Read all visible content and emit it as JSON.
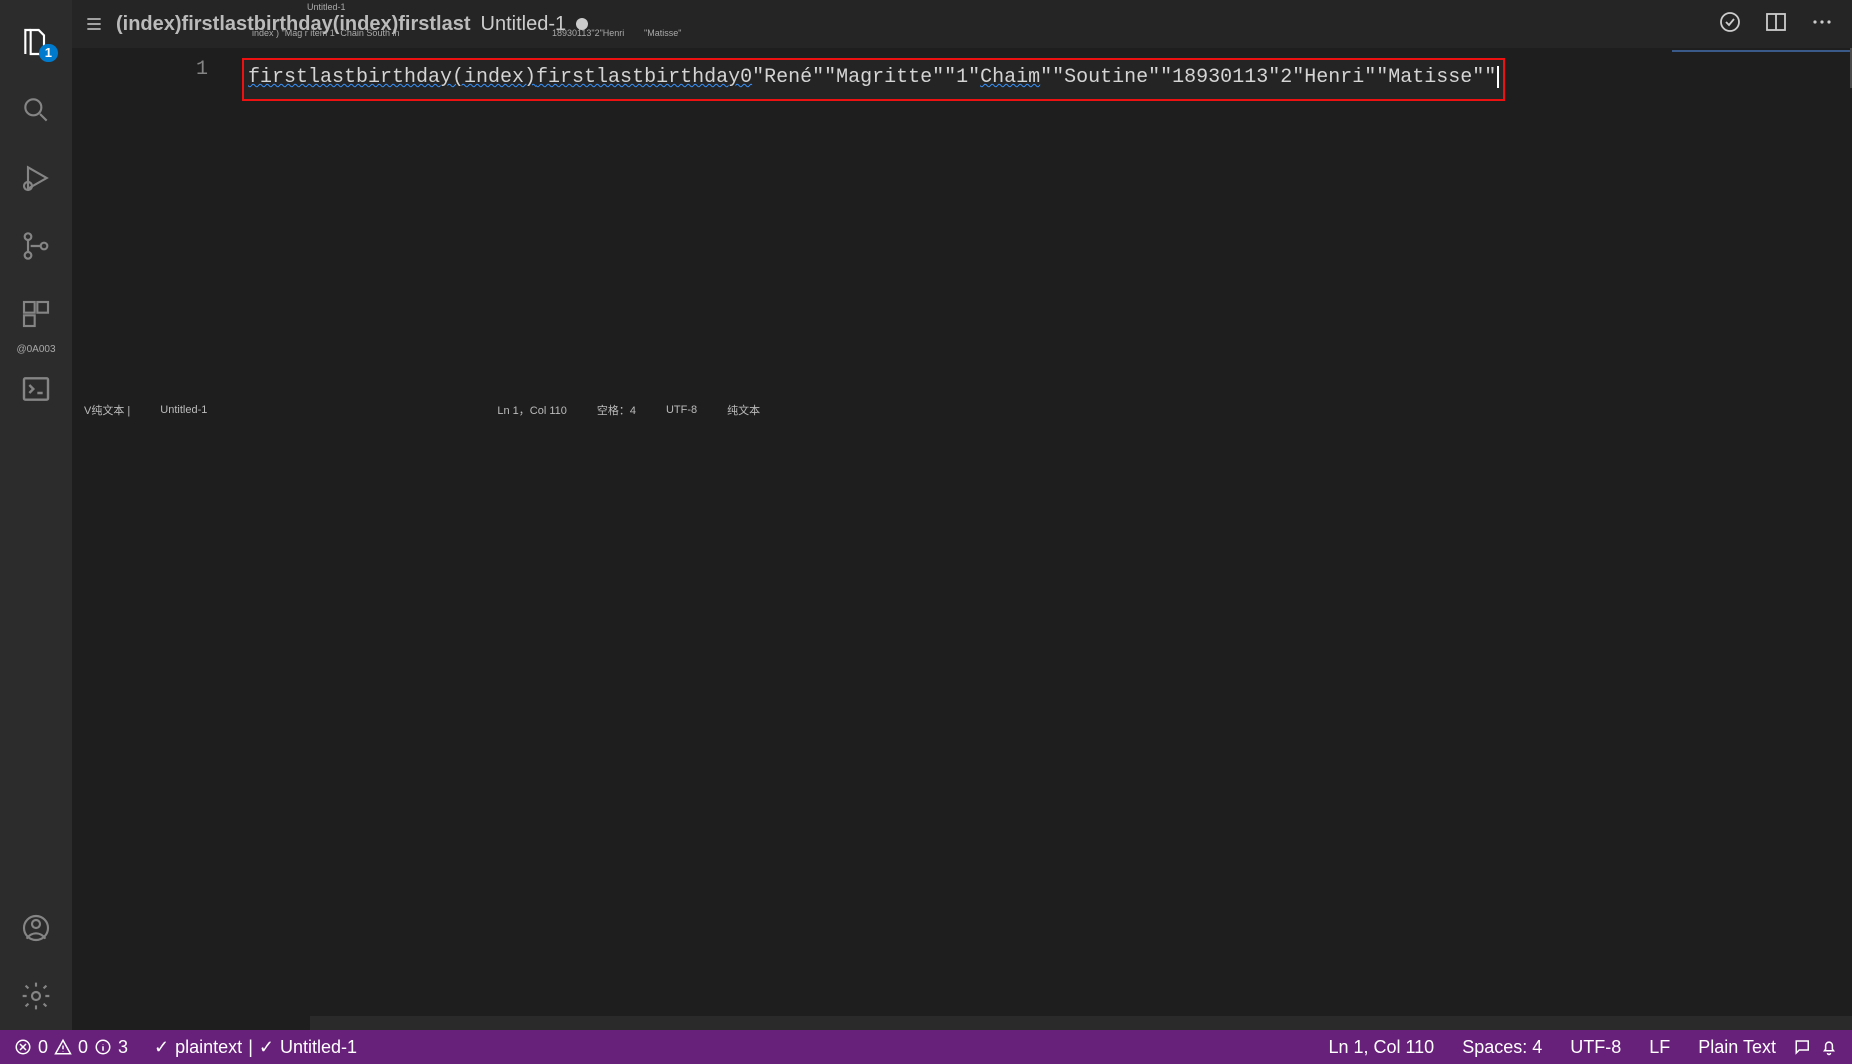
{
  "activity": {
    "explorer_badge": "1",
    "account_label": "@0A003"
  },
  "tabs": {
    "context_text": "(index)firstlastbirthday(index)firstlast",
    "active_tab": "Untitled-1",
    "tiny1": "Untitled-1",
    "tiny2": "index ) \"Mag r item 1\" Chain South in",
    "tiny3": "18930113\"2\"Henri",
    "tiny4": "\"Matisse\""
  },
  "editor": {
    "line_number": "1",
    "code_pre": "firstlastbirthday(index)",
    "code_mid": "firstlastbirthday0",
    "code_post": "\"René\"\"Magritte\"\"1\"",
    "code_chaim": "Chaim",
    "code_post2": "\"\"Soutine\"\"18930113\"2\"Henri\"\"Matisse\"",
    "code_quote_dq": "\""
  },
  "inner_status": {
    "left_label": "V纯文本 |",
    "file": "Untitled-1",
    "pos": "Ln 1，Col 110",
    "indent": "空格：4",
    "encoding": "UTF-8",
    "lang": "纯文本"
  },
  "status": {
    "errors": "0",
    "warnings": "0",
    "info": "3",
    "lint_mode": "plaintext",
    "lint_sep": "|",
    "filename": "Untitled-1",
    "cursor": "Ln 1, Col 110",
    "indent": "Spaces: 4",
    "encoding": "UTF-8",
    "eol": "LF",
    "language": "Plain Text"
  }
}
